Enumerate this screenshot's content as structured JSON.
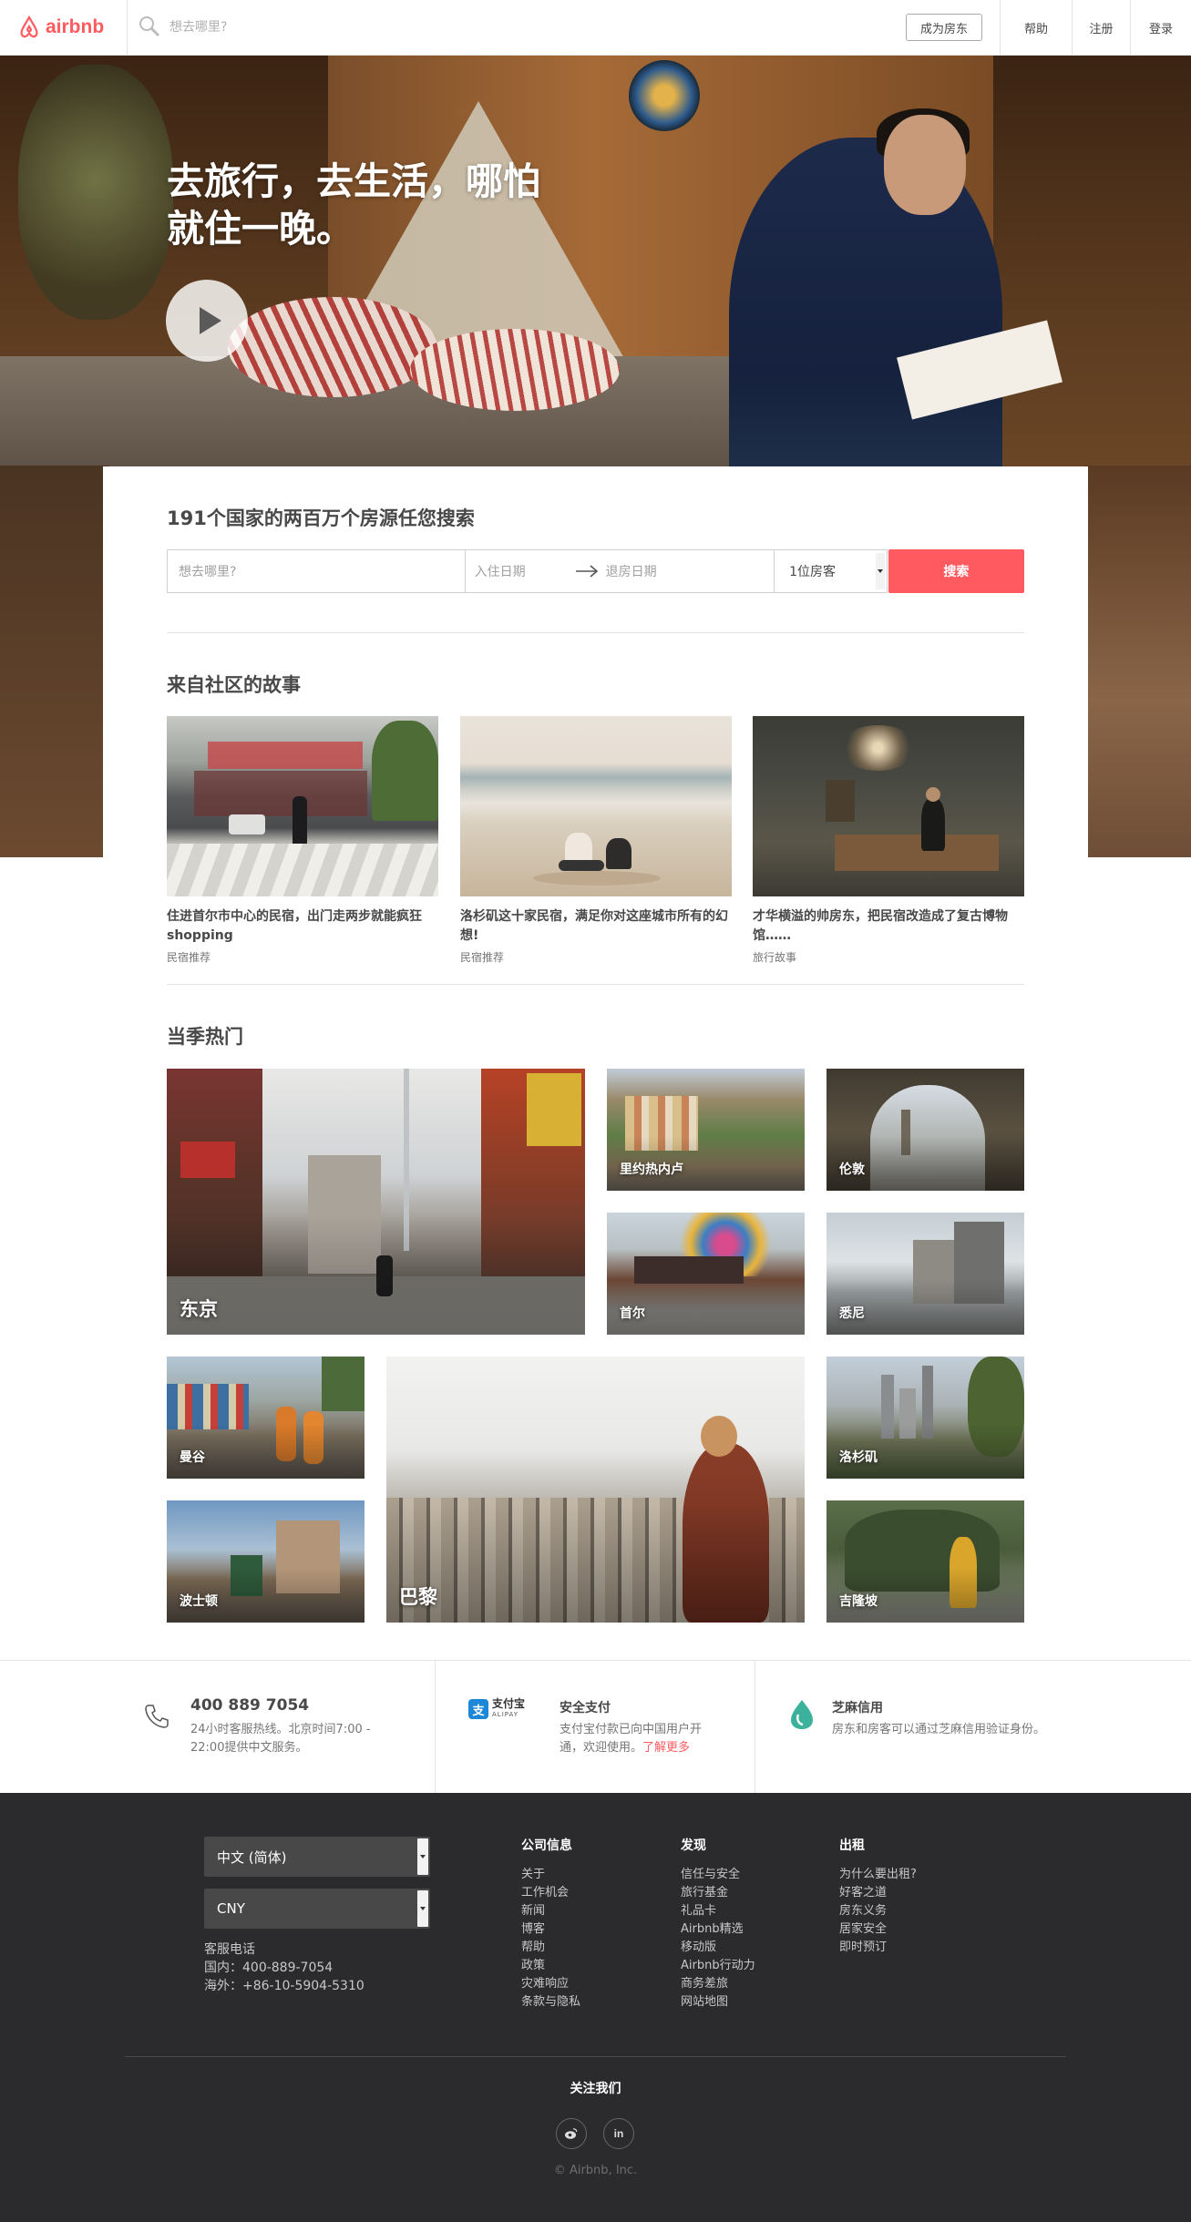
{
  "header": {
    "logo_text": "airbnb",
    "search_placeholder": "想去哪里?",
    "become_host": "成为房东",
    "help": "帮助",
    "signup": "注册",
    "login": "登录"
  },
  "hero": {
    "title": "去旅行，去生活，哪怕就住一晚。"
  },
  "search": {
    "title": "191个国家的两百万个房源任您搜索",
    "where_placeholder": "想去哪里?",
    "checkin_placeholder": "入住日期",
    "checkout_placeholder": "退房日期",
    "guests_value": "1位房客",
    "button": "搜索"
  },
  "stories": {
    "title": "来自社区的故事",
    "items": [
      {
        "title": "住进首尔市中心的民宿，出门走两步就能疯狂shopping",
        "category": "民宿推荐"
      },
      {
        "title": "洛杉矶这十家民宿，满足你对这座城市所有的幻想!",
        "category": "民宿推荐"
      },
      {
        "title": "才华横溢的帅房东，把民宿改造成了复古博物馆……",
        "category": "旅行故事"
      }
    ]
  },
  "popular": {
    "title": "当季热门",
    "cities": [
      "东京",
      "里约热内卢",
      "伦敦",
      "首尔",
      "悉尼",
      "曼谷",
      "巴黎",
      "洛杉矶",
      "波士顿",
      "吉隆坡"
    ]
  },
  "info": {
    "phone": "400 889 7054",
    "phone_desc": "24小时客服热线。北京时间7:00 - 22:00提供中文服务。",
    "alipay_logo": "支付宝",
    "alipay_logo_en": "ALIPAY",
    "pay_title": "安全支付",
    "pay_desc": "支付宝付款已向中国用户开通，欢迎使用。",
    "pay_link": "了解更多",
    "credit_title": "芝麻信用",
    "credit_desc": "房东和房客可以通过芝麻信用验证身份。"
  },
  "footer": {
    "language": "中文 (简体)",
    "currency": "CNY",
    "support_label": "客服电话",
    "support_domestic": "国内：400-889-7054",
    "support_overseas": "海外：+86-10-5904-5310",
    "col1": {
      "title": "公司信息",
      "items": [
        "关于",
        "工作机会",
        "新闻",
        "博客",
        "帮助",
        "政策",
        "灾难响应",
        "条款与隐私"
      ]
    },
    "col2": {
      "title": "发现",
      "items": [
        "信任与安全",
        "旅行基金",
        "礼品卡",
        "Airbnb精选",
        "移动版",
        "Airbnb行动力",
        "商务差旅",
        "网站地图"
      ]
    },
    "col3": {
      "title": "出租",
      "items": [
        "为什么要出租?",
        "好客之道",
        "房东义务",
        "居家安全",
        "即时预订"
      ]
    },
    "follow": "关注我们",
    "copyright": "© Airbnb, Inc."
  },
  "colors": {
    "brand": "#ff5a5f",
    "footer_bg": "#2b2b2d"
  },
  "icons": [
    "airbnb-logo-icon",
    "search-icon",
    "play-icon",
    "arrow-right-icon",
    "caret-down-icon",
    "phone-icon",
    "alipay-icon",
    "sesame-credit-icon",
    "weibo-icon",
    "linkedin-icon"
  ]
}
